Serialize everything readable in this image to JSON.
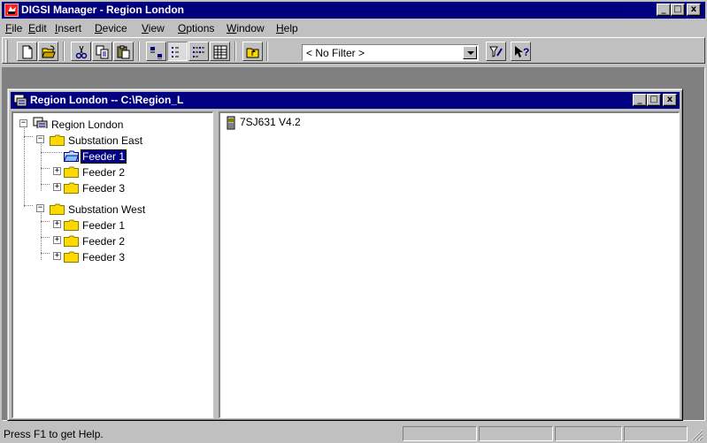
{
  "window": {
    "title": "DIGSI Manager - Region London",
    "buttons": {
      "minimize": "_",
      "maximize": "□",
      "close": "x"
    }
  },
  "menu": [
    "File",
    "Edit",
    "Insert",
    "Device",
    "View",
    "Options",
    "Window",
    "Help"
  ],
  "menu_mnemonics": [
    "F",
    "E",
    "I",
    "D",
    "V",
    "O",
    "W",
    "H"
  ],
  "toolbar": {
    "buttons": [
      "new-icon",
      "open-icon",
      "cut-icon",
      "copy-icon",
      "paste-icon",
      "large-icons-icon",
      "small-icons-icon",
      "list-icon",
      "details-icon",
      "up-one-level-icon",
      "filter-settings-icon",
      "help-pointer-icon"
    ],
    "filter": {
      "value": "< No Filter >"
    }
  },
  "child_window": {
    "title": "Region London -- C:\\Region_L"
  },
  "tree": {
    "root": "Region London",
    "nodes": [
      {
        "label": "Substation East",
        "expanded": true
      },
      {
        "label": "Feeder 1",
        "selected": true,
        "open": true
      },
      {
        "label": "Feeder 2",
        "expanded": false
      },
      {
        "label": "Feeder 3",
        "expanded": false
      },
      {
        "label": "Substation West",
        "expanded": true
      },
      {
        "label": "Feeder 1",
        "expanded": false
      },
      {
        "label": "Feeder 2",
        "expanded": false
      },
      {
        "label": "Feeder 3",
        "expanded": false
      }
    ]
  },
  "list": {
    "items": [
      "7SJ631 V4.2"
    ]
  },
  "status": {
    "text": "Press F1 to get Help."
  },
  "colors": {
    "title_bar": "#000080",
    "face": "#c0c0c0",
    "folder": "#ffd800",
    "selection": "#000080"
  }
}
